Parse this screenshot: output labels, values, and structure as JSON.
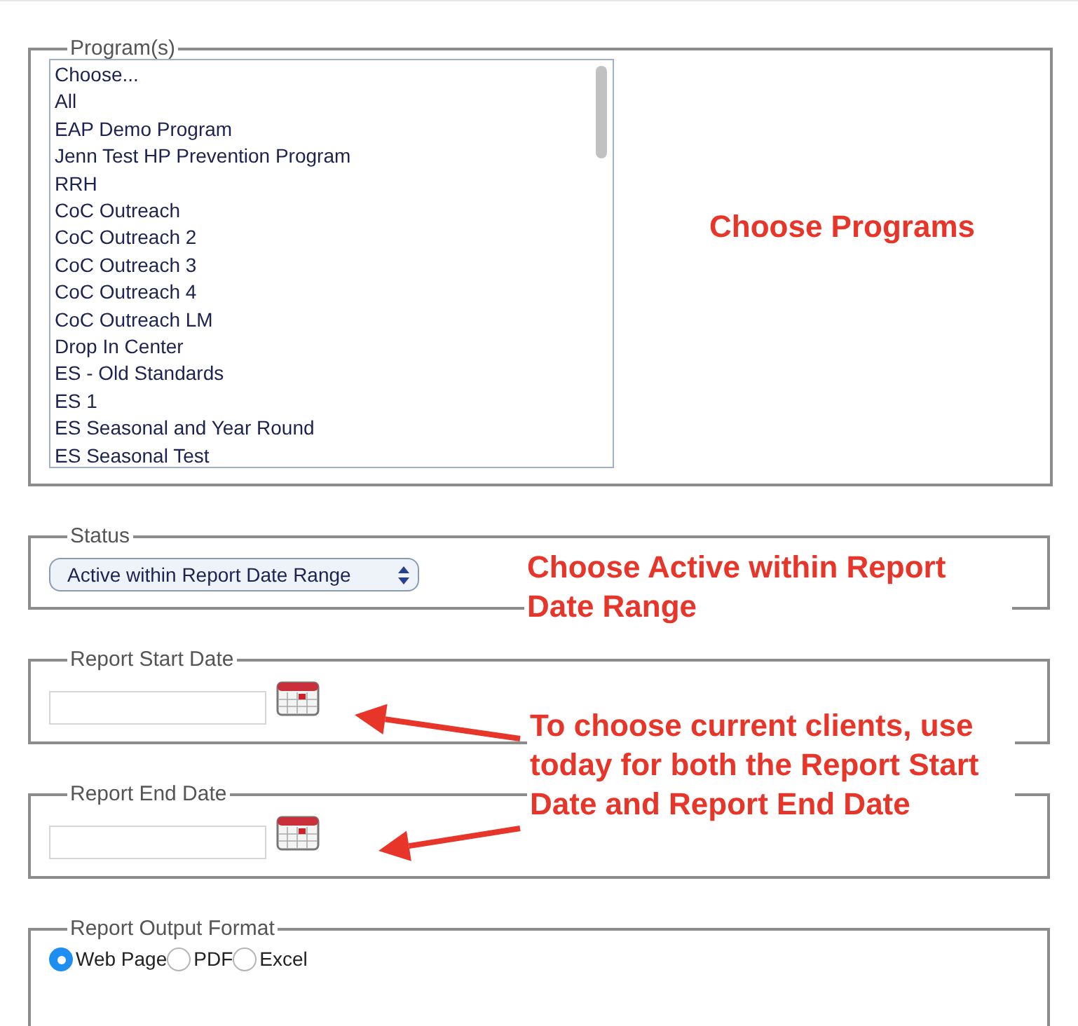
{
  "programs": {
    "legend": "Program(s)",
    "options": [
      {
        "label": "Choose...",
        "selected": false
      },
      {
        "label": "All",
        "selected": false
      },
      {
        "label": "EAP Demo Program",
        "selected": false
      },
      {
        "label": "Jenn Test HP Prevention Program",
        "selected": false
      },
      {
        "label": "RRH",
        "selected": false
      },
      {
        "label": "CoC Outreach",
        "selected": false
      },
      {
        "label": "CoC Outreach 2",
        "selected": false
      },
      {
        "label": "CoC Outreach 3",
        "selected": false
      },
      {
        "label": "CoC Outreach 4",
        "selected": false
      },
      {
        "label": "CoC Outreach LM",
        "selected": false
      },
      {
        "label": "Drop In Center",
        "selected": false
      },
      {
        "label": "ES - Old Standards",
        "selected": false
      },
      {
        "label": "ES 1",
        "selected": false
      },
      {
        "label": "ES Seasonal and Year Round",
        "selected": false
      },
      {
        "label": "ES Seasonal Test",
        "selected": false
      }
    ]
  },
  "status": {
    "legend": "Status",
    "value": "Active within Report Date Range"
  },
  "report_start_date": {
    "legend": "Report Start Date"
  },
  "report_end_date": {
    "legend": "Report End Date"
  },
  "report_output_format": {
    "legend": "Report Output Format",
    "options": [
      {
        "label": "Web Page",
        "selected": true
      },
      {
        "label": "PDF",
        "selected": false
      },
      {
        "label": "Excel",
        "selected": false
      }
    ]
  },
  "annotations": [
    {
      "kind": "programs",
      "text": "Choose Programs"
    },
    {
      "kind": "status",
      "text": "Choose Active within Report Date Range"
    },
    {
      "kind": "dates",
      "text": "To choose current clients, use today for both the Report Start Date and Report End Date"
    }
  ]
}
